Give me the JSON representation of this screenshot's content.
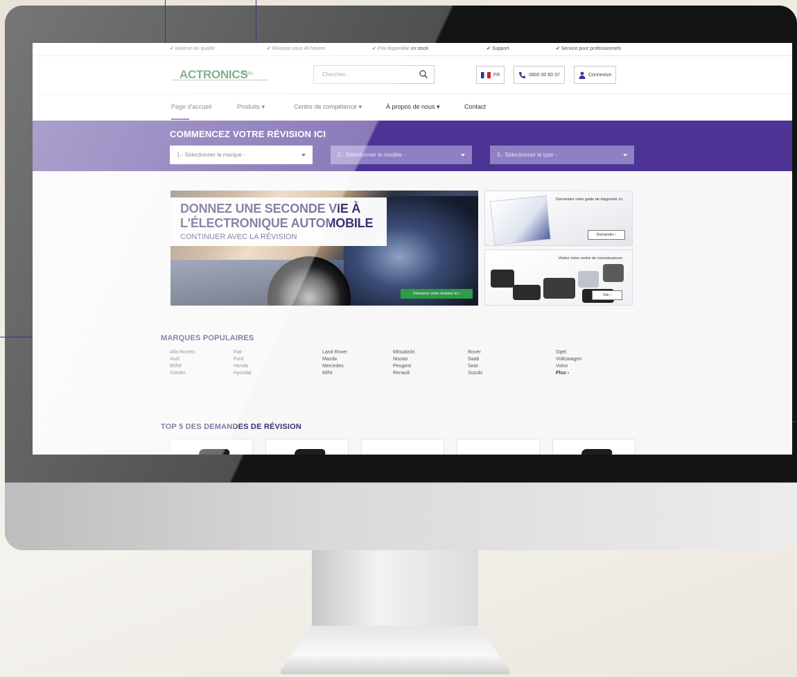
{
  "topbar": {
    "items": [
      "Matériel de qualité",
      "Révision sous 48 heures",
      "Prix disponible en stock",
      "Support",
      "Service pour professionnels"
    ]
  },
  "header": {
    "logo_text": "ACTRONICS",
    "logo_suffix": "SARL",
    "search_placeholder": "Chercher...",
    "language": "FR",
    "phone": "0800 00 60 37",
    "login_label": "Connexion"
  },
  "nav": {
    "items": [
      "Page d'accueil",
      "Produits ▾",
      "Centre de compétence ▾",
      "À propos de nous ▾",
      "Contact"
    ]
  },
  "revision_band": {
    "title": "COMMENCEZ VOTRE RÉVISION ICI",
    "selects": [
      "1.- Sélectionner la marque -",
      "2.- Sélectionner le modèle -",
      "3.- Sélectionner le type -"
    ]
  },
  "hero": {
    "line1": "DONNEZ UNE SECONDE VIE À",
    "line2": "L'ÉLECTRONIQUE AUTOMOBILE",
    "line3": "CONTINUER AVEC LA RÉVISION",
    "cta_label": "Démarrez votre révision ici ›"
  },
  "side_cards": [
    {
      "title": "Demandez votre guide de diagnostic ici",
      "button": "Demander ›"
    },
    {
      "title": "Visitez notre centre de connaissances",
      "button": "Voir ›"
    }
  ],
  "brands": {
    "title": "MARQUES POPULAIRES",
    "columns": [
      [
        "Alfa Romeo",
        "Audi",
        "BMW",
        "Citroën"
      ],
      [
        "Fiat",
        "Ford",
        "Honda",
        "Hyundai"
      ],
      [
        "Land Rover",
        "Mazda",
        "Mercedes",
        "MINI"
      ],
      [
        "Mitsubishi",
        "Nissan",
        "Peugeot",
        "Renault"
      ],
      [
        "Rover",
        "Saab",
        "Seat",
        "Suzuki"
      ],
      [
        "Opel",
        "Volkswagen",
        "Volvo",
        "Plus ›"
      ]
    ]
  },
  "top5": {
    "title": "TOP 5 DES DEMANDES DE RÉVISION"
  }
}
